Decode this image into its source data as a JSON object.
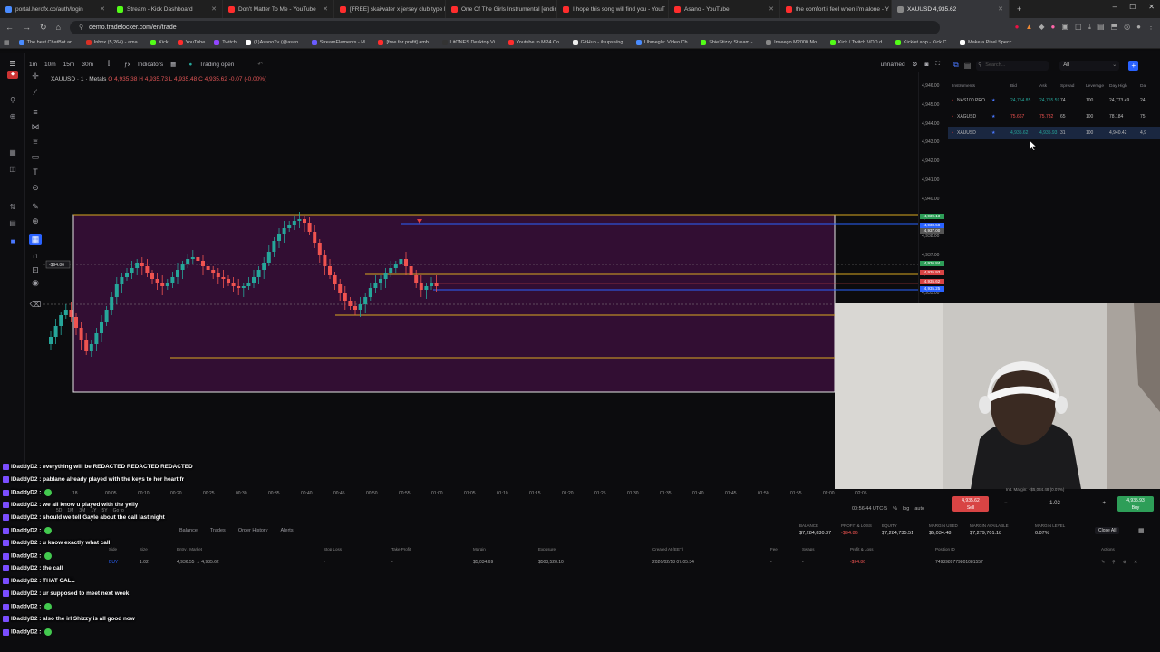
{
  "browser": {
    "tabs": [
      {
        "label": "portal.herofx.co/auth/login",
        "color": "#4a8cff"
      },
      {
        "label": "Stream - Kick Dashboard",
        "color": "#53fc18"
      },
      {
        "label": "Don't Matter To Me - YouTube",
        "color": "#ff2d2d"
      },
      {
        "label": "[FREE] skaiwater x jersey club type b",
        "color": "#ff2d2d"
      },
      {
        "label": "One Of The Girls Instrumental [endin",
        "color": "#ff2d2d"
      },
      {
        "label": "I hope this song will find you - YouT",
        "color": "#ff2d2d"
      },
      {
        "label": "Asano - YouTube",
        "color": "#ff2d2d"
      },
      {
        "label": "the comfort i feel when i'm alone - Y",
        "color": "#ff2d2d"
      },
      {
        "label": "XAUUSD 4,935.62",
        "color": "#888888"
      }
    ],
    "url": "demo.tradelocker.com/en/trade",
    "bookmarks": [
      "The best ChatBot an...",
      "Inbox (5,264) - ama...",
      "Kick",
      "YouTube",
      "Twitch",
      "(1)AsanoTv (@asan...",
      "StreamElements - M...",
      "[free for profit] amb...",
      "LitONES Desktop Vi...",
      "Youtube to MP4 Co...",
      "GitHub - ilsupsa/ng...",
      "Uhmegle: Video Ch...",
      "ShieStizzy Stream -...",
      "Inseego M2000 Mo...",
      "Kick / Twitch VOD d...",
      "Kicklet.app - Kick C...",
      "Make a Pixel Specc..."
    ]
  },
  "chart": {
    "timeframes": [
      "1m",
      "10m",
      "15m",
      "30m"
    ],
    "indicators_label": "Indicators",
    "trading_open": "Trading open",
    "layout_name": "unnamed",
    "symbol_line": "XAUUSD · 1 · Metals",
    "ohlc": "O 4,935.38 H 4,935.73 L 4,935.48 C 4,935.62",
    "change": "-0.07 (-0.00%)",
    "price_labels": [
      "4,946.00",
      "4,945.00",
      "4,944.00",
      "4,943.00",
      "4,942.00",
      "4,941.00",
      "4,940.00",
      "4,939.00",
      "4,938.00",
      "4,937.00",
      "4,936.00",
      "4,935.00",
      "4,934.00"
    ],
    "price_badges": [
      {
        "text": "4,939.13",
        "color": "#2e9e58"
      },
      {
        "text": "4,938.58",
        "color": "#2962ff"
      },
      {
        "text": "4,937.00",
        "color": "#555555"
      },
      {
        "text": "4,936.84",
        "color": "#2e9e58"
      },
      {
        "text": "4,935.93",
        "color": "#d84444"
      },
      {
        "text": "4,935.62",
        "color": "#d84444"
      },
      {
        "text": "4,935.25",
        "color": "#2962ff"
      }
    ],
    "time_labels": [
      "18",
      "00:05",
      "00:10",
      "00:20",
      "00:25",
      "00:30",
      "00:35",
      "00:40",
      "00:45",
      "00:50",
      "00:55",
      "01:00",
      "01:05",
      "01:10",
      "01:15",
      "01:20",
      "01:25",
      "01:30",
      "01:35",
      "01:40",
      "01:45",
      "01:50",
      "01:55",
      "02:00",
      "02:05"
    ],
    "clock": "00:56:44 UTC-5",
    "scale_options": [
      "%",
      "log",
      "auto"
    ],
    "range_buttons": [
      "5D",
      "1M",
      "3M",
      "1Y",
      "5Y",
      "Go to"
    ],
    "pl_tag": "-$94.86"
  },
  "instruments": {
    "search_placeholder": "Search...",
    "filter": "All",
    "columns": [
      "Instruments",
      "Bid",
      "Ask",
      "Spread",
      "Leverage",
      "Day High",
      "Da"
    ],
    "rows": [
      {
        "name": "NAS100.PRO",
        "bid": "24,754.85",
        "ask": "24,755.59",
        "spread": "74",
        "leverage": "100",
        "high": "24,773.49",
        "low": "24",
        "selected": false
      },
      {
        "name": "XAGUSD",
        "bid": "75.667",
        "ask": "75.732",
        "spread": "65",
        "leverage": "100",
        "high": "78.184",
        "low": "75",
        "selected": false
      },
      {
        "name": "XAUUSD",
        "bid": "4,935.62",
        "ask": "4,935.93",
        "spread": "31",
        "leverage": "100",
        "high": "4,940.42",
        "low": "4,9",
        "selected": true
      }
    ]
  },
  "order": {
    "sell_price": "4,935.62",
    "sell_label": "Sell",
    "buy_price": "4,935.93",
    "buy_label": "Buy",
    "qty": "1.02",
    "margin": "Init. Margin: ~$5,034.48 (0.07%)"
  },
  "account": {
    "tabs": [
      "Balance",
      "Trades",
      "Order History",
      "Alerts"
    ],
    "metrics": [
      {
        "label": "BALANCE",
        "value": "$7,284,830.37"
      },
      {
        "label": "PROFIT & LOSS",
        "value": "-$94.86"
      },
      {
        "label": "EQUITY",
        "value": "$7,284,735.51"
      },
      {
        "label": "MARGIN USED",
        "value": "$5,034.48"
      },
      {
        "label": "MARGIN AVAILABLE",
        "value": "$7,279,701.18"
      },
      {
        "label": "MARGIN LEVEL",
        "value": "0.07%"
      }
    ],
    "close_all": "Close All",
    "position_headers": [
      "Side",
      "Size",
      "Entry / Market",
      "Stop Loss",
      "Take Profit",
      "Margin",
      "Exposure",
      "Created At (EET)",
      "Fee",
      "Swaps",
      "Profit & Loss",
      "Position ID",
      "Actions"
    ],
    "position": {
      "side": "BUY",
      "size": "1.02",
      "entry": "4,936.55 → 4,935.62",
      "sl": "-",
      "tp": "-",
      "margin": "$5,034.69",
      "exposure": "$503,528.10",
      "created": "2026/02/18 07:05:34",
      "fee": "-",
      "swaps": "-",
      "pnl": "-$94.86",
      "id": "7493989779801081557"
    }
  },
  "chat": [
    {
      "user": "IDaddyD2",
      "text": "everything will be REDACTED REDACTED REDACTED",
      "emote": false
    },
    {
      "user": "IDaddyD2",
      "text": "pablano already played with the keys to her heart fr",
      "emote": false
    },
    {
      "user": "IDaddyD2",
      "text": "",
      "emote": true
    },
    {
      "user": "IDaddyD2",
      "text": "we all know u played with the yelly",
      "emote": false
    },
    {
      "user": "IDaddyD2",
      "text": "should we tell Gayle about the call last night",
      "emote": false
    },
    {
      "user": "IDaddyD2",
      "text": "",
      "emote": true
    },
    {
      "user": "IDaddyD2",
      "text": "u know exactly what call",
      "emote": false
    },
    {
      "user": "IDaddyD2",
      "text": "",
      "emote": true
    },
    {
      "user": "IDaddyD2",
      "text": "the call",
      "emote": false
    },
    {
      "user": "IDaddyD2",
      "text": "THAT CALL",
      "emote": false
    },
    {
      "user": "IDaddyD2",
      "text": "ur supposed to meet next week",
      "emote": false
    },
    {
      "user": "IDaddyD2",
      "text": "",
      "emote": true
    },
    {
      "user": "IDaddyD2",
      "text": "also the irl Shizzy is all good now",
      "emote": false
    },
    {
      "user": "IDaddyD2",
      "text": "",
      "emote": true
    }
  ],
  "colors": {
    "accent": "#2962ff",
    "up": "#26a69a",
    "down": "#ef5350",
    "zone": "#3a0f3a",
    "gold_line": "#d9a820"
  }
}
